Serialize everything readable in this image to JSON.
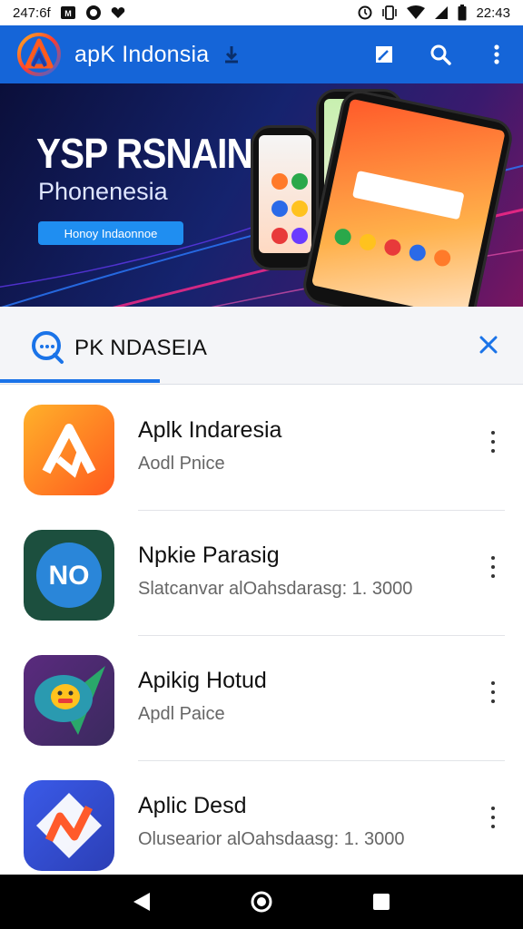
{
  "status_bar": {
    "left_text": "247:6f",
    "time": "22:43",
    "icons": [
      "app-badge-icon",
      "whatsapp-icon",
      "heart-icon",
      "alarm-icon",
      "vibrate-icon",
      "wifi-icon",
      "signal-icon",
      "battery-icon"
    ]
  },
  "app_bar": {
    "title": "apK Indonsia",
    "actions": [
      "edit-icon",
      "search-icon",
      "more-vert-icon"
    ]
  },
  "banner": {
    "title": "YSP RSNAIN",
    "subtitle": "Phonenesia",
    "button_label": "Honoy Indaonnoe"
  },
  "search": {
    "query": "PK NDASEIA",
    "close_icon": "close-icon"
  },
  "apps": [
    {
      "title": "Aplk Indaresia",
      "subtitle": "Aodl Pnice",
      "icon": "apk-a-icon",
      "icon_colors": [
        "#ff6a1e",
        "#ffb12a"
      ]
    },
    {
      "title": "Npkie Parasig",
      "subtitle": "Slatcanvar alOahsdarasg: 1. 3000",
      "icon": "no-badge-icon",
      "icon_label": "NO",
      "icon_colors": [
        "#1c4f3e",
        "#2a86d9"
      ]
    },
    {
      "title": "Apikig Hotud",
      "subtitle": "Apdl Paice",
      "icon": "chat-bubble-icon",
      "icon_colors": [
        "#4a2a6e",
        "#2aa8a0"
      ]
    },
    {
      "title": "Aplic Desd",
      "subtitle": "Olusearior alOahsdaasg: 1. 3000",
      "icon": "n-arrow-icon",
      "icon_colors": [
        "#2c4fd6",
        "#ff5a2a"
      ]
    }
  ],
  "colors": {
    "app_bar": "#1565d8",
    "accent": "#1a73e8",
    "banner_button": "#1f8ef1"
  },
  "nav_bar": {
    "buttons": [
      "back-icon",
      "home-icon",
      "recents-icon"
    ]
  }
}
